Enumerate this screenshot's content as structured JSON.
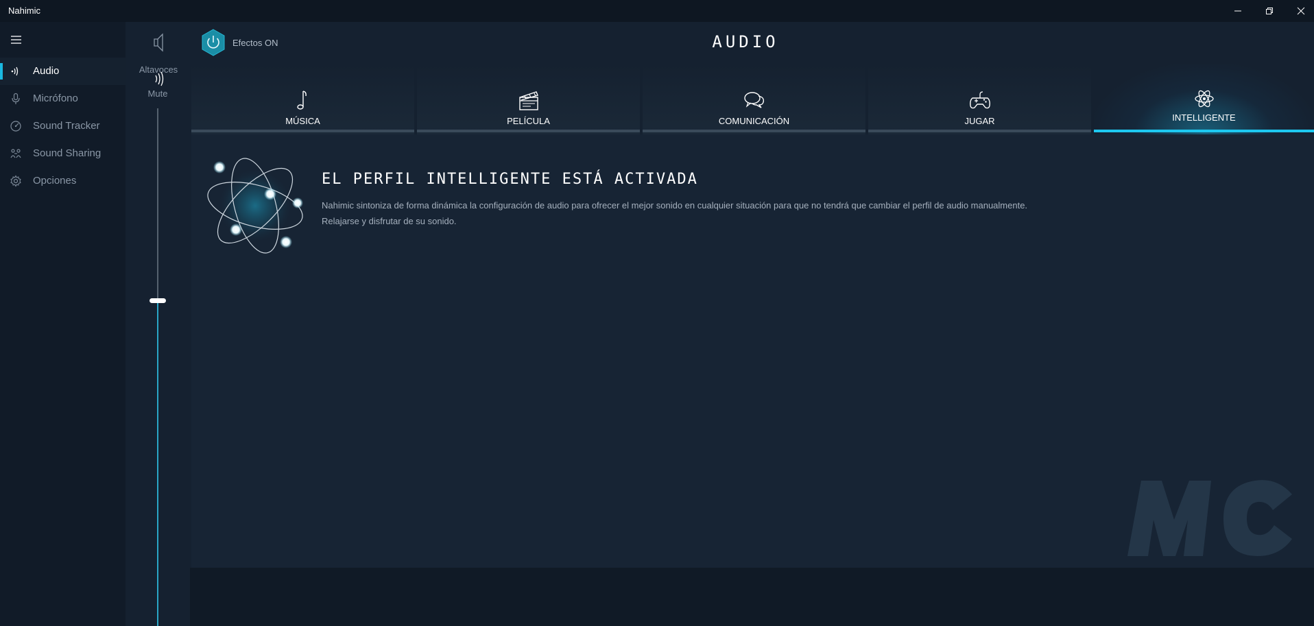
{
  "app": {
    "title": "Nahimic"
  },
  "nav": {
    "items": [
      {
        "label": "Audio",
        "icon": "audio-waves-icon",
        "active": true
      },
      {
        "label": "Micrófono",
        "icon": "microphone-icon",
        "active": false
      },
      {
        "label": "Sound Tracker",
        "icon": "radar-icon",
        "active": false
      },
      {
        "label": "Sound Sharing",
        "icon": "share-icon",
        "active": false
      },
      {
        "label": "Opciones",
        "icon": "gear-icon",
        "active": false
      }
    ]
  },
  "volume": {
    "device_label": "Altavoces",
    "mute_label": "Mute",
    "level_fraction": 0.28
  },
  "header": {
    "effects_label": "Efectos ON",
    "page_title": "AUDIO"
  },
  "tabs": [
    {
      "label": "MÚSICA",
      "icon": "music-note-icon",
      "active": false
    },
    {
      "label": "PELÍCULA",
      "icon": "clapperboard-icon",
      "active": false
    },
    {
      "label": "COMUNICACIÓN",
      "icon": "chat-bubbles-icon",
      "active": false
    },
    {
      "label": "JUGAR",
      "icon": "gamepad-icon",
      "active": false
    },
    {
      "label": "INTELLIGENTE",
      "icon": "atom-icon",
      "active": true
    }
  ],
  "profile": {
    "title": "EL PERFIL INTELLIGENTE ESTÁ ACTIVADA",
    "description_line1": "Nahimic sintoniza de forma dinámica la configuración de audio para ofrecer el mejor sonido en cualquier situación para que no tendrá que cambiar el perfil de audio manualmente.",
    "description_line2": "Relajarse y disfrutar de su sonido."
  },
  "watermark": {
    "text": "MC"
  },
  "colors": {
    "accent": "#1ec8f0",
    "background": "#152130",
    "nav_background": "#111b28"
  }
}
